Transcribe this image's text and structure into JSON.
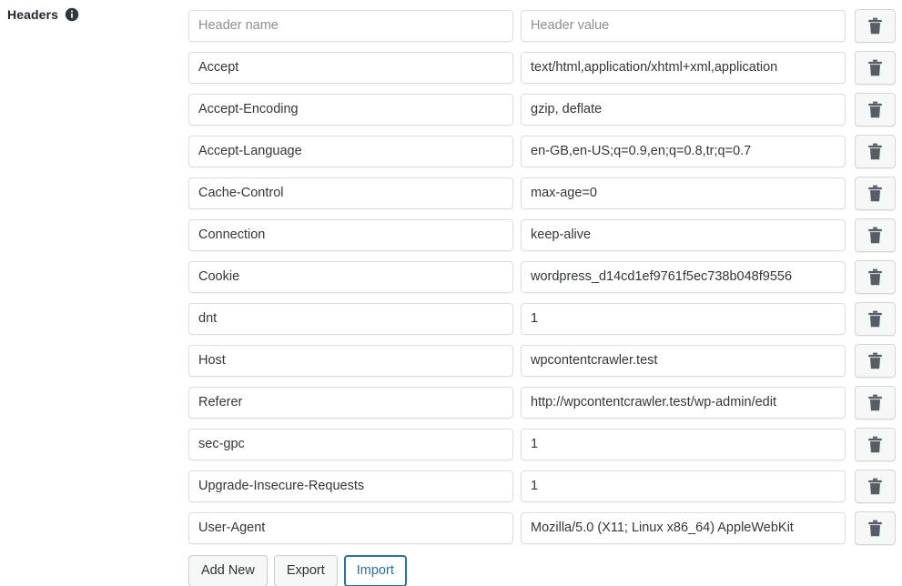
{
  "section": {
    "label": "Headers",
    "info_icon": "info-circle-icon",
    "info_tooltip": "Headers"
  },
  "placeholders": {
    "name": "Header name",
    "value": "Header value"
  },
  "icons": {
    "delete": "trash-icon"
  },
  "colors": {
    "accent": "#2271b1",
    "input_border": "#dddddd",
    "button_bg": "#f6f7f7",
    "text": "#32373c",
    "placeholder": "#8a8f94"
  },
  "rows": [
    {
      "name": "",
      "value": "",
      "empty": true
    },
    {
      "name": "Accept",
      "value": "text/html,application/xhtml+xml,application",
      "empty": false
    },
    {
      "name": "Accept-Encoding",
      "value": "gzip, deflate",
      "empty": false
    },
    {
      "name": "Accept-Language",
      "value": "en-GB,en-US;q=0.9,en;q=0.8,tr;q=0.7",
      "empty": false
    },
    {
      "name": "Cache-Control",
      "value": "max-age=0",
      "empty": false
    },
    {
      "name": "Connection",
      "value": "keep-alive",
      "empty": false
    },
    {
      "name": "Cookie",
      "value": "wordpress_d14cd1ef9761f5ec738b048f9556",
      "empty": false
    },
    {
      "name": "dnt",
      "value": "1",
      "empty": false
    },
    {
      "name": "Host",
      "value": "wpcontentcrawler.test",
      "empty": false
    },
    {
      "name": "Referer",
      "value": "http://wpcontentcrawler.test/wp-admin/edit",
      "empty": false
    },
    {
      "name": "sec-gpc",
      "value": "1",
      "empty": false
    },
    {
      "name": "Upgrade-Insecure-Requests",
      "value": "1",
      "empty": false
    },
    {
      "name": "User-Agent",
      "value": "Mozilla/5.0 (X11; Linux x86_64) AppleWebKit",
      "empty": false
    }
  ],
  "buttons": {
    "add_new": "Add New",
    "export": "Export",
    "import": "Import"
  }
}
